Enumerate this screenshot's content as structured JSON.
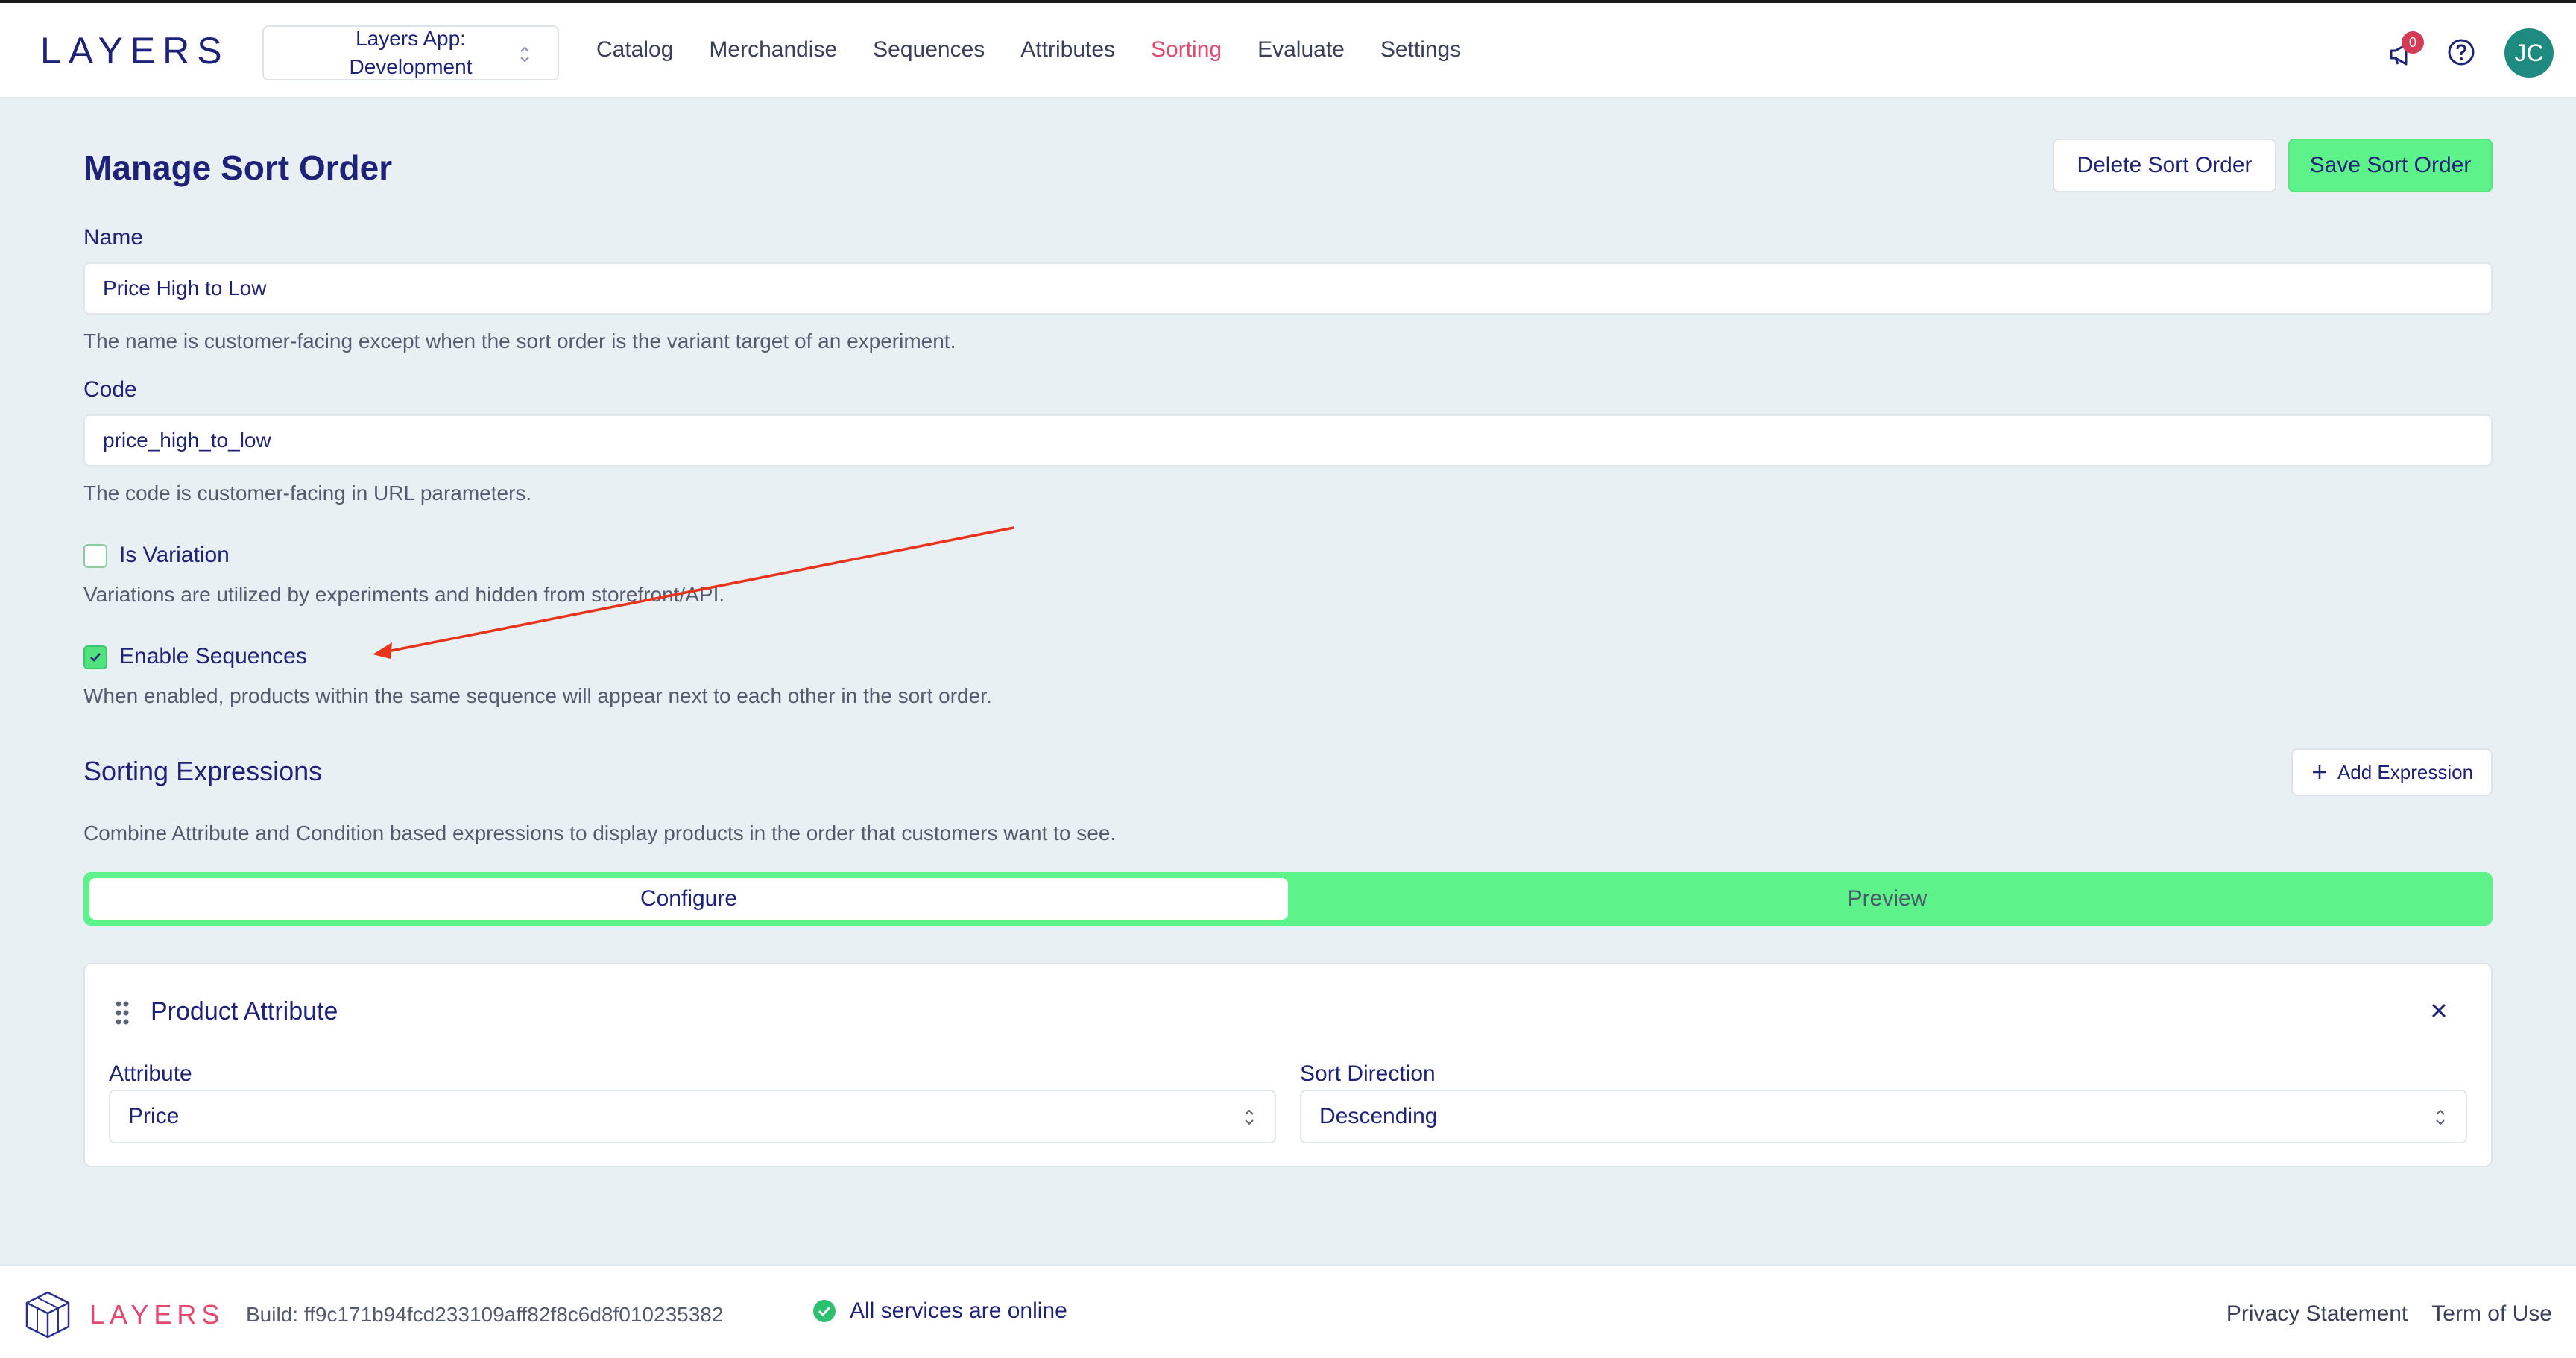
{
  "header": {
    "logo_text": "LAYERS",
    "env_line1": "Layers App:",
    "env_line2": "Development",
    "nav": [
      "Catalog",
      "Merchandise",
      "Sequences",
      "Attributes",
      "Sorting",
      "Evaluate",
      "Settings"
    ],
    "active_nav": "Sorting",
    "notification_count": "0",
    "avatar_initials": "JC"
  },
  "page": {
    "title": "Manage Sort Order",
    "delete_label": "Delete Sort Order",
    "save_label": "Save Sort Order"
  },
  "form": {
    "name_label": "Name",
    "name_value": "Price High to Low",
    "name_help": "The name is customer-facing except when the sort order is the variant target of an experiment.",
    "code_label": "Code",
    "code_value": "price_high_to_low",
    "code_help": "The code is customer-facing in URL parameters.",
    "is_variation_label": "Is Variation",
    "is_variation_checked": false,
    "is_variation_help": "Variations are utilized by experiments and hidden from storefront/API.",
    "enable_sequences_label": "Enable Sequences",
    "enable_sequences_checked": true,
    "enable_sequences_help": "When enabled, products within the same sequence will appear next to each other in the sort order."
  },
  "sorting": {
    "title": "Sorting Expressions",
    "add_label": "Add Expression",
    "description": "Combine Attribute and Condition based expressions to display products in the order that customers want to see.",
    "tabs": [
      "Configure",
      "Preview"
    ],
    "active_tab": "Configure",
    "card": {
      "title": "Product Attribute",
      "attribute_label": "Attribute",
      "attribute_value": "Price",
      "direction_label": "Sort Direction",
      "direction_value": "Descending"
    }
  },
  "footer": {
    "logo_text": "LAYERS",
    "build": "Build: ff9c171b94fcd233109aff82f8c6d8f010235382",
    "status": "All services are online",
    "links": [
      "Privacy Statement",
      "Term of Use"
    ]
  },
  "colors": {
    "accent_green": "#5ef28a",
    "navy": "#1f2378",
    "active_pink": "#e5476e",
    "annotation_red": "#e8341c"
  }
}
